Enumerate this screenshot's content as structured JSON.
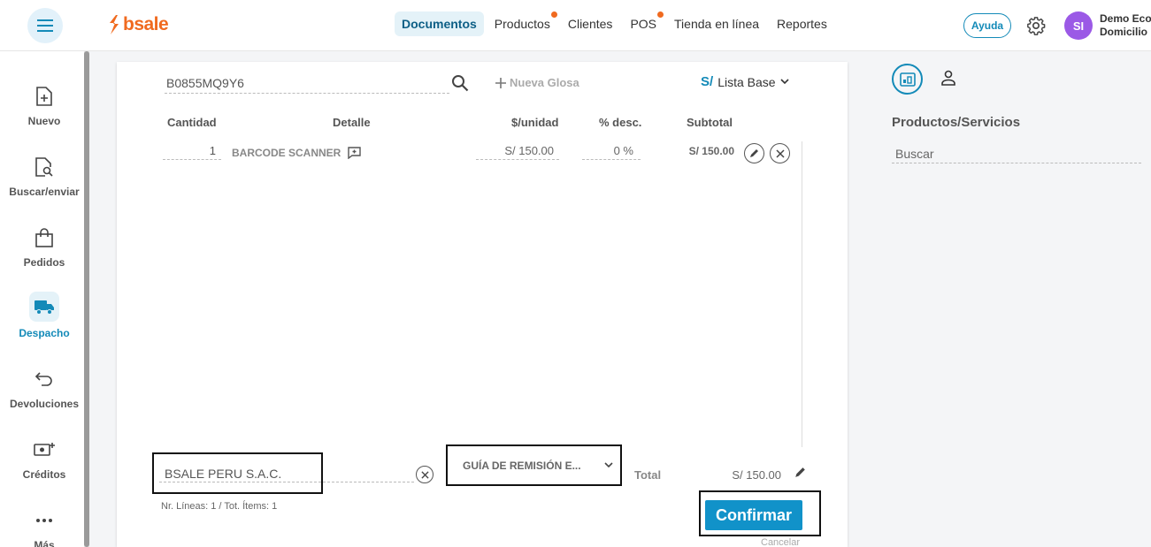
{
  "brand": {
    "name": "bsale"
  },
  "nav": {
    "items": [
      {
        "label": "Documentos",
        "active": true,
        "dot": false
      },
      {
        "label": "Productos",
        "active": false,
        "dot": true
      },
      {
        "label": "Clientes",
        "active": false,
        "dot": false
      },
      {
        "label": "POS",
        "active": false,
        "dot": true
      },
      {
        "label": "Tienda en línea",
        "active": false,
        "dot": false
      },
      {
        "label": "Reportes",
        "active": false,
        "dot": false
      }
    ]
  },
  "header": {
    "help_label": "Ayuda",
    "avatar_initials": "SI",
    "user_line1": "Demo Eco",
    "user_line2": "Domicilio"
  },
  "sidebar": {
    "items": [
      {
        "label": "Nuevo",
        "icon": "new-document-icon",
        "active": false
      },
      {
        "label": "Buscar/enviar",
        "icon": "search-document-icon",
        "active": false
      },
      {
        "label": "Pedidos",
        "icon": "bag-icon",
        "active": false
      },
      {
        "label": "Despacho",
        "icon": "truck-icon",
        "active": true
      },
      {
        "label": "Devoluciones",
        "icon": "return-arrow-icon",
        "active": false
      },
      {
        "label": "Créditos",
        "icon": "credit-icon",
        "active": false
      },
      {
        "label": "Más",
        "icon": "more-icon",
        "active": false
      }
    ]
  },
  "document": {
    "code": "B0855MQ9Y6",
    "add_gloss_label": "Nueva Glosa",
    "currency_symbol": "S/",
    "price_list": "Lista Base",
    "columns": {
      "quantity": "Cantidad",
      "detail": "Detalle",
      "unit_price": "$/unidad",
      "discount": "% desc.",
      "subtotal": "Subtotal"
    },
    "rows": [
      {
        "quantity": "1",
        "detail": "BARCODE SCANNER",
        "unit_price": "S/ 150.00",
        "discount": "0 %",
        "subtotal": "S/ 150.00"
      }
    ],
    "client": "BSALE PERU S.A.C.",
    "doc_type": "GUÍA DE REMISIÓN E...",
    "total_label": "Total",
    "total_value": "S/ 150.00",
    "summary": "Nr. Líneas: 1 / Tot. Ítems: 1",
    "confirm_label": "Confirmar",
    "cancel_label": "Cancelar"
  },
  "right_panel": {
    "title": "Productos/Servicios",
    "search_placeholder": "Buscar"
  },
  "colors": {
    "accent": "#138ab8",
    "brand": "#f06a1f",
    "confirm": "#1192c9",
    "avatar": "#9b59e6"
  }
}
